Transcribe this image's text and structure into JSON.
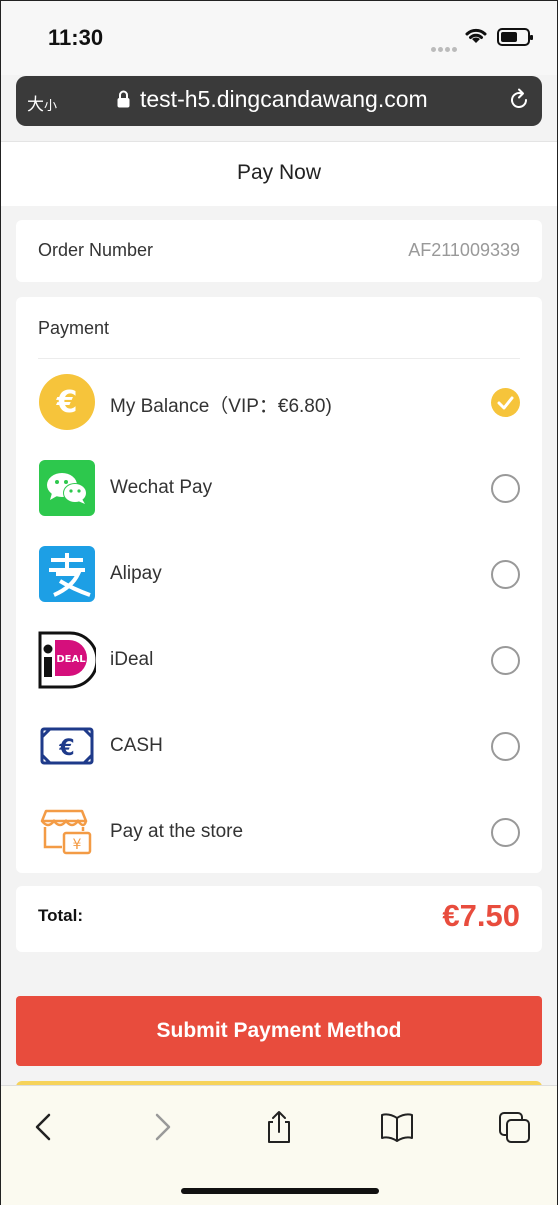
{
  "status": {
    "time": "11:30"
  },
  "browser": {
    "text_size_big": "大",
    "text_size_small": "小",
    "url": "test-h5.dingcandawang.com"
  },
  "header": {
    "title": "Pay Now"
  },
  "order": {
    "label": "Order Number",
    "value": "AF211009339"
  },
  "payment": {
    "heading": "Payment",
    "options": [
      {
        "label": "My Balance（VIP：€6.80)",
        "icon": "euro-coin-icon",
        "selected": true
      },
      {
        "label": "Wechat Pay",
        "icon": "wechat-icon",
        "selected": false
      },
      {
        "label": "Alipay",
        "icon": "alipay-icon",
        "selected": false
      },
      {
        "label": "iDeal",
        "icon": "ideal-icon",
        "selected": false
      },
      {
        "label": "CASH",
        "icon": "cash-icon",
        "selected": false
      },
      {
        "label": "Pay at the store",
        "icon": "store-icon",
        "selected": false
      }
    ]
  },
  "total": {
    "label": "Total:",
    "value": "€7.50"
  },
  "actions": {
    "submit_label": "Submit Payment Method"
  },
  "colors": {
    "accent_red": "#e84c3d",
    "accent_yellow": "#f6c43b",
    "wechat_green": "#2dc84d",
    "alipay_blue": "#1d9fe5"
  }
}
